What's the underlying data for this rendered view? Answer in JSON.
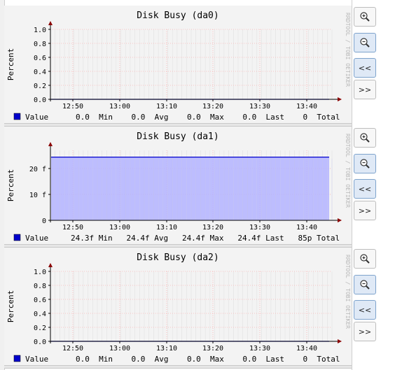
{
  "graphs": [
    {
      "title": "Disk Busy (da0)",
      "ylabel": "Percent",
      "watermark": "RRDTOOL / TOBI OETIKER",
      "y_ticks": [
        "1.0",
        "0.8",
        "0.6",
        "0.4",
        "0.2",
        "0.0"
      ],
      "x_ticks": [
        "12:50",
        "13:00",
        "13:10",
        "13:20",
        "13:30",
        "13:40"
      ],
      "legend": {
        "series": "Value",
        "stats_text": "0.0  Min    0.0  Avg    0.0  Max    0.0  Last    0  Total"
      },
      "chart_data": {
        "type": "area",
        "x": [
          "12:50",
          "13:00",
          "13:10",
          "13:20",
          "13:30",
          "13:40"
        ],
        "ylim": [
          0,
          1.0
        ],
        "series": [
          {
            "name": "Value",
            "values": [
              0,
              0,
              0,
              0,
              0,
              0
            ],
            "color": "#b3b3ff",
            "line_color": "#0000cc"
          }
        ]
      }
    },
    {
      "title": "Disk Busy (da1)",
      "ylabel": "Percent",
      "watermark": "RRDTOOL / TOBI OETIKER",
      "y_ticks": [
        "20 f",
        "10 f",
        "0"
      ],
      "x_ticks": [
        "12:50",
        "13:00",
        "13:10",
        "13:20",
        "13:30",
        "13:40"
      ],
      "legend": {
        "series": "Value",
        "stats_text": "24.3f Min   24.4f Avg   24.4f Max   24.4f Last   85p Total"
      },
      "chart_data": {
        "type": "area",
        "x": [
          "12:50",
          "13:00",
          "13:10",
          "13:20",
          "13:30",
          "13:40"
        ],
        "ylim": [
          0,
          27
        ],
        "series": [
          {
            "name": "Value",
            "values": [
              24.4,
              24.4,
              24.4,
              24.4,
              24.4,
              24.4
            ],
            "color": "#b3b3ff",
            "line_color": "#0000cc"
          }
        ]
      }
    },
    {
      "title": "Disk Busy (da2)",
      "ylabel": "Percent",
      "watermark": "RRDTOOL / TOBI OETIKER",
      "y_ticks": [
        "1.0",
        "0.8",
        "0.6",
        "0.4",
        "0.2",
        "0.0"
      ],
      "x_ticks": [
        "12:50",
        "13:00",
        "13:10",
        "13:20",
        "13:30",
        "13:40"
      ],
      "legend": {
        "series": "Value",
        "stats_text": "0.0  Min    0.0  Avg    0.0  Max    0.0  Last    0  Total"
      },
      "chart_data": {
        "type": "area",
        "x": [
          "12:50",
          "13:00",
          "13:10",
          "13:20",
          "13:30",
          "13:40"
        ],
        "ylim": [
          0,
          1.0
        ],
        "series": [
          {
            "name": "Value",
            "values": [
              0,
              0,
              0,
              0,
              0,
              0
            ],
            "color": "#b3b3ff",
            "line_color": "#0000cc"
          }
        ]
      }
    }
  ],
  "buttons": {
    "zoom_in_icon": "zoom-in-icon",
    "zoom_out_icon": "zoom-out-icon",
    "prev_label": "<<",
    "next_label": ">>"
  },
  "colors": {
    "panel_bg": "#f3f3f3",
    "grid": "#ff9999",
    "axis": "#000000",
    "arrow": "#8b0000",
    "area": "#b3b3ff",
    "line": "#0000cc",
    "legend_swatch": "#0000cc"
  }
}
